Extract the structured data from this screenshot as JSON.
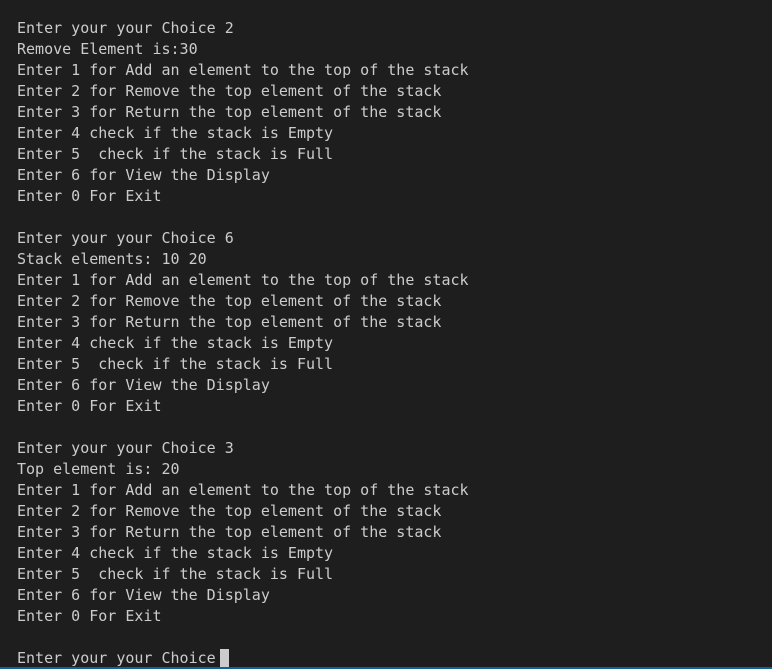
{
  "terminal": {
    "lines": [
      "Enter your your Choice 2",
      "Remove Element is:30",
      "Enter 1 for Add an element to the top of the stack",
      "Enter 2 for Remove the top element of the stack",
      "Enter 3 for Return the top element of the stack",
      "Enter 4 check if the stack is Empty",
      "Enter 5  check if the stack is Full",
      "Enter 6 for View the Display",
      "Enter 0 For Exit",
      "",
      "Enter your your Choice 6",
      "Stack elements: 10 20",
      "Enter 1 for Add an element to the top of the stack",
      "Enter 2 for Remove the top element of the stack",
      "Enter 3 for Return the top element of the stack",
      "Enter 4 check if the stack is Empty",
      "Enter 5  check if the stack is Full",
      "Enter 6 for View the Display",
      "Enter 0 For Exit",
      "",
      "Enter your your Choice 3",
      "Top element is: 20",
      "Enter 1 for Add an element to the top of the stack",
      "Enter 2 for Remove the top element of the stack",
      "Enter 3 for Return the top element of the stack",
      "Enter 4 check if the stack is Empty",
      "Enter 5  check if the stack is Full",
      "Enter 6 for View the Display",
      "Enter 0 For Exit",
      ""
    ],
    "prompt": "Enter your your Choice"
  },
  "colors": {
    "background": "#1e1e1e",
    "text": "#cccccc",
    "cursor": "#cccccc",
    "accent_edge": "#0e639c"
  }
}
